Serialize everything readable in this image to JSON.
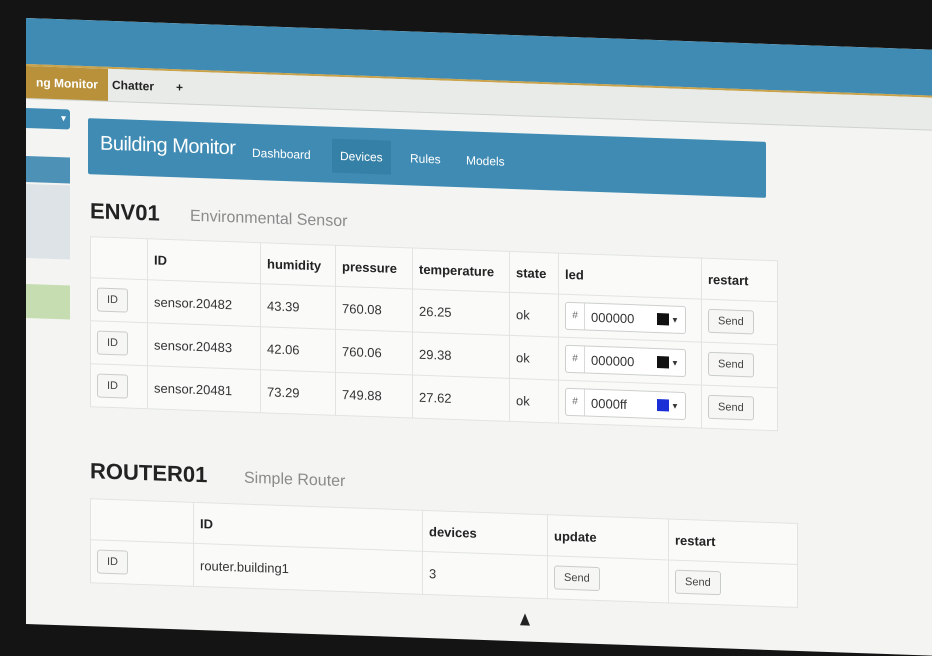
{
  "tabs": [
    {
      "label": "ng Monitor",
      "active": true
    },
    {
      "label": "Chatter",
      "active": false
    },
    {
      "label": "+",
      "active": false
    }
  ],
  "sidebar": {
    "dropdown_caret": "▾"
  },
  "nav": {
    "brand": "Building Monitor",
    "links": [
      "Dashboard",
      "Devices",
      "Rules",
      "Models"
    ],
    "active": "Devices"
  },
  "env": {
    "title": "ENV01",
    "subtitle": "Environmental Sensor",
    "headers": [
      "",
      "ID",
      "humidity",
      "pressure",
      "temperature",
      "state",
      "led",
      "restart"
    ],
    "rows": [
      {
        "id_btn": "ID",
        "id": "sensor.20482",
        "humidity": "43.39",
        "pressure": "760.08",
        "temperature": "26.25",
        "state": "ok",
        "hash": "#",
        "led": "000000",
        "led_color": "#111111",
        "send": "Send"
      },
      {
        "id_btn": "ID",
        "id": "sensor.20483",
        "humidity": "42.06",
        "pressure": "760.06",
        "temperature": "29.38",
        "state": "ok",
        "hash": "#",
        "led": "000000",
        "led_color": "#111111",
        "send": "Send"
      },
      {
        "id_btn": "ID",
        "id": "sensor.20481",
        "humidity": "73.29",
        "pressure": "749.88",
        "temperature": "27.62",
        "state": "ok",
        "hash": "#",
        "led": "0000ff",
        "led_color": "#1a2fd6",
        "send": "Send"
      }
    ]
  },
  "router": {
    "title": "ROUTER01",
    "subtitle": "Simple Router",
    "headers": [
      "",
      "ID",
      "devices",
      "update",
      "restart"
    ],
    "rows": [
      {
        "id_btn": "ID",
        "id": "router.building1",
        "devices": "3",
        "update": "Send",
        "restart": "Send"
      }
    ]
  },
  "colors": {
    "primary": "#3f8bb3",
    "accent": "#b8913a"
  }
}
